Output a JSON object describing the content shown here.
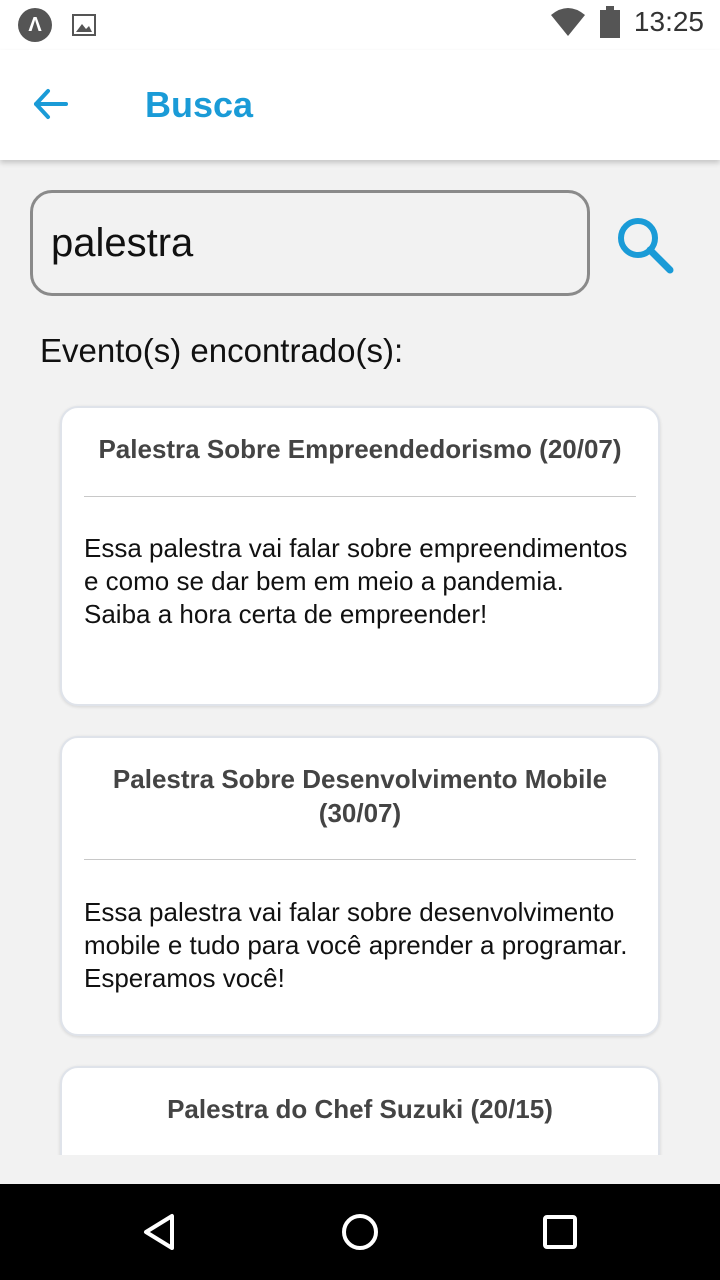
{
  "status_bar": {
    "app_badge": "Λ",
    "time": "13:25",
    "icons": [
      "app-badge-icon",
      "image-icon",
      "wifi-icon",
      "battery-icon"
    ]
  },
  "app_bar": {
    "title": "Busca",
    "back_icon": "back-arrow-icon"
  },
  "search": {
    "value": "palestra",
    "icon": "search-icon"
  },
  "results_label": "Evento(s) encontrado(s):",
  "events": [
    {
      "title": "Palestra Sobre Empreendedorismo (20/07)",
      "description": "Essa palestra vai falar sobre empreendimentos e como se dar bem em meio a pandemia. Saiba a hora certa de empreender!"
    },
    {
      "title": "Palestra Sobre Desenvolvimento Mobile (30/07)",
      "description": "Essa palestra vai falar sobre desenvolvimento mobile e tudo para você aprender a programar. Esperamos você!"
    },
    {
      "title": "Palestra do Chef Suzuki (20/15)",
      "description": ""
    }
  ],
  "nav_bar": {
    "icons": [
      "back-triangle-icon",
      "home-circle-icon",
      "recents-square-icon"
    ]
  },
  "colors": {
    "accent": "#1a9bd7",
    "background": "#f2f2f2",
    "card": "#ffffff"
  }
}
